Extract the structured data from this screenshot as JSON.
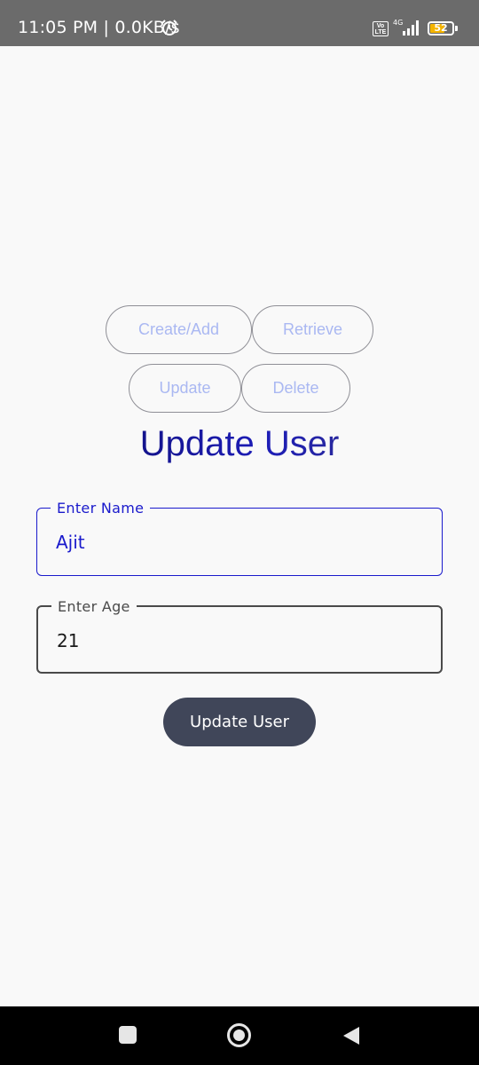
{
  "status_bar": {
    "time": "11:05 PM | 0.0KB/s",
    "volte": "Vo LTE",
    "network": "4G",
    "battery_level": "52",
    "icons": [
      "alarm-icon",
      "volte-icon",
      "signal-icon",
      "battery-icon"
    ]
  },
  "nav_buttons": {
    "create": "Create/Add",
    "retrieve": "Retrieve",
    "update": "Update",
    "delete": "Delete"
  },
  "title": "Update User",
  "form": {
    "name": {
      "label": "Enter Name",
      "value": "Ajit"
    },
    "age": {
      "label": "Enter Age",
      "value": "21"
    }
  },
  "submit_label": "Update User",
  "system_nav": {
    "icons": [
      "recents-icon",
      "home-icon",
      "back-icon"
    ]
  },
  "colors": {
    "accent": "#1a1acc",
    "nav_button_text": "#aab8f2",
    "submit_bg": "#404659",
    "background": "#f9f9f9",
    "status_bar": "#6b6b6b",
    "battery": "#f4b400"
  }
}
